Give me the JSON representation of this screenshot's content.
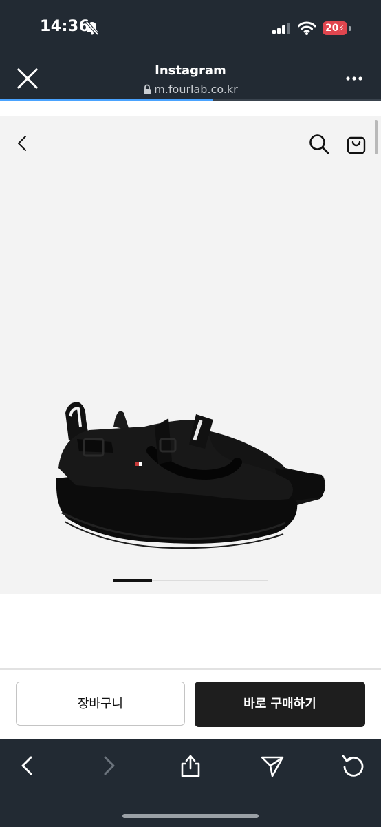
{
  "status_bar": {
    "time": "14:36",
    "battery": "20"
  },
  "browser": {
    "title": "Instagram",
    "url": "m.fourlab.co.kr",
    "load_progress": 0.56
  },
  "product": {
    "carousel_position": 0.25
  },
  "actions": {
    "cart_label": "장바구니",
    "buy_label": "바로 구매하기"
  },
  "colors": {
    "chrome_bg": "#222a33",
    "progress_blue": "#4aa3ff",
    "battery_red": "#e0464f",
    "buy_button": "#1e1e1e"
  },
  "icons": {
    "close": "close-icon",
    "more": "more-icon",
    "back": "chevron-left-icon",
    "search": "search-icon",
    "bag": "shopping-bag-icon",
    "share": "share-icon",
    "send": "send-icon",
    "reload": "reload-icon"
  }
}
